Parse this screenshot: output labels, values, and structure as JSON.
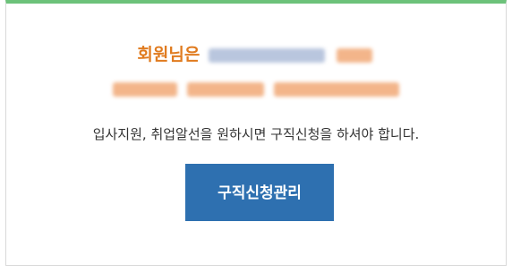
{
  "greeting": {
    "name_label": "회원님은"
  },
  "notice": {
    "text": "입사지원, 취업알선을 원하시면 구직신청을 하셔야 합니다."
  },
  "actions": {
    "job_application_manage_label": "구직신청관리"
  },
  "colors": {
    "accent_top_border": "#6cc27a",
    "greeting_text": "#e07b1f",
    "button_bg": "#2e70b0",
    "button_text": "#ffffff"
  }
}
